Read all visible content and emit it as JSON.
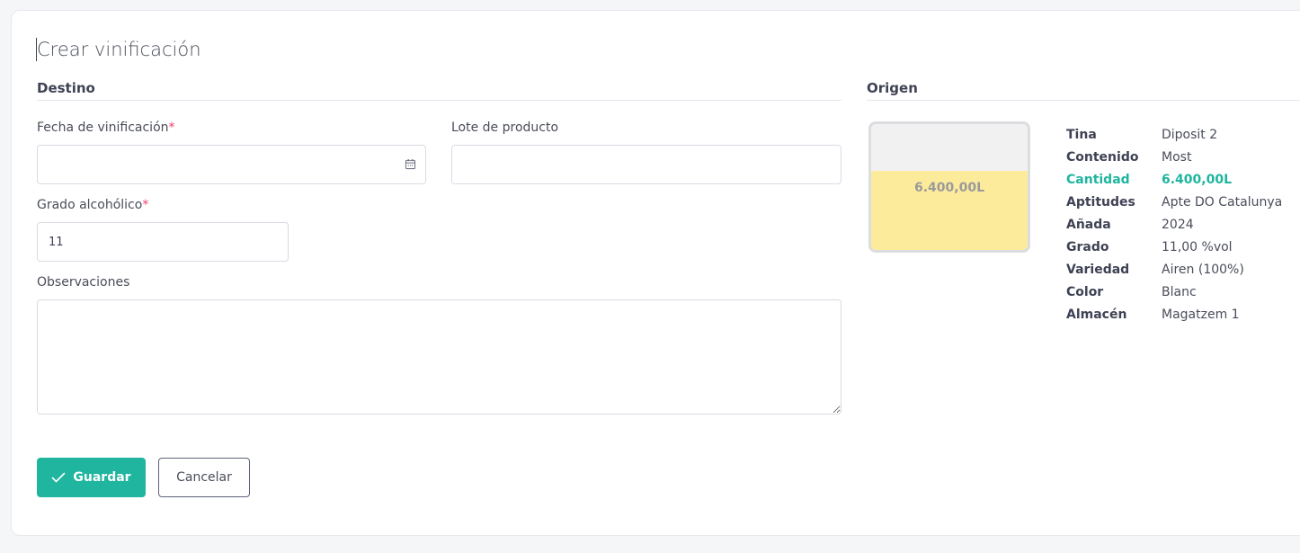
{
  "page": {
    "title": "Crear vinificación"
  },
  "destino": {
    "section_title": "Destino",
    "fecha_label": "Fecha de vinificación",
    "fecha_value": "",
    "lote_label": "Lote de producto",
    "lote_value": "",
    "grado_label": "Grado alcohólico",
    "grado_value": "11",
    "obs_label": "Observaciones",
    "obs_value": "",
    "required_mark": "*"
  },
  "actions": {
    "save_label": "Guardar",
    "cancel_label": "Cancelar"
  },
  "origen": {
    "section_title": "Origen",
    "tank": {
      "amount_label": "6.400,00L",
      "fill_fraction": 0.63,
      "fill_color": "#fdeb9c"
    },
    "details": [
      {
        "key": "Tina",
        "value": "Diposit 2"
      },
      {
        "key": "Contenido",
        "value": "Most"
      },
      {
        "key": "Cantidad",
        "value": "6.400,00L",
        "highlight": true
      },
      {
        "key": "Aptitudes",
        "value": "Apte DO Catalunya"
      },
      {
        "key": "Añada",
        "value": "2024"
      },
      {
        "key": "Grado",
        "value": "11,00 %vol"
      },
      {
        "key": "Variedad",
        "value": "Airen (100%)"
      },
      {
        "key": "Color",
        "value": "Blanc"
      },
      {
        "key": "Almacén",
        "value": "Magatzem 1"
      }
    ]
  },
  "colors": {
    "accent": "#1fb59f",
    "required": "#f1416c"
  }
}
